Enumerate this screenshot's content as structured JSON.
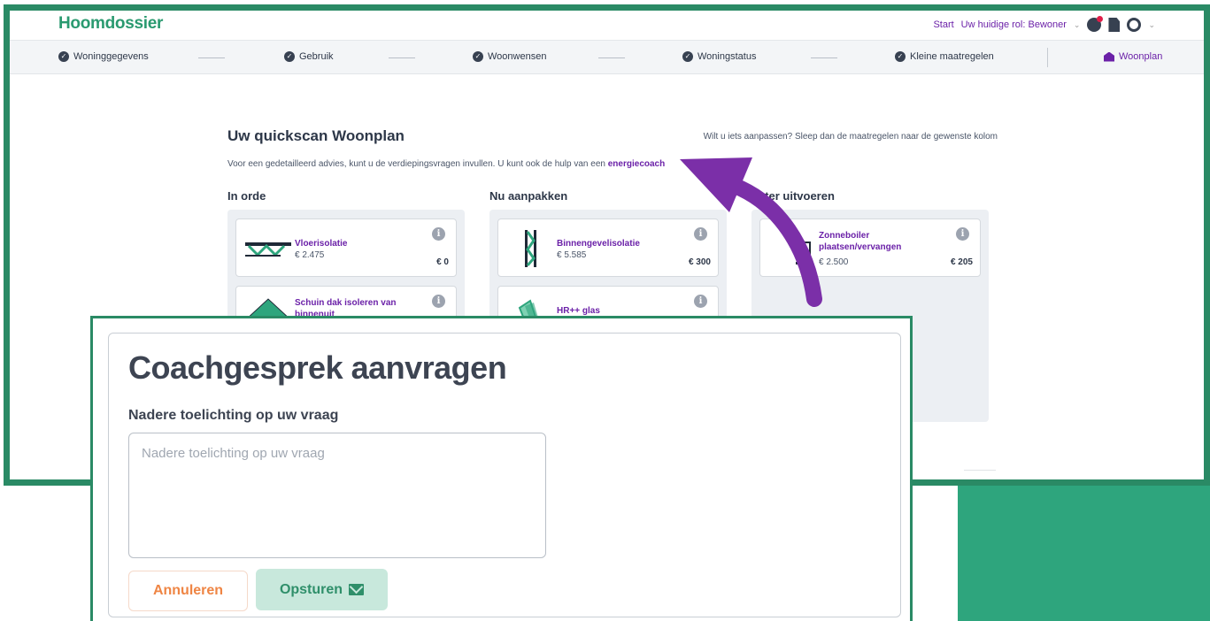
{
  "app": {
    "logo": "Hoomdossier"
  },
  "topnav": {
    "start": "Start",
    "role_label": "Uw huidige rol: Bewoner"
  },
  "steps": [
    {
      "label": "Woninggegevens"
    },
    {
      "label": "Gebruik"
    },
    {
      "label": "Woonwensen"
    },
    {
      "label": "Woningstatus"
    },
    {
      "label": "Kleine maatregelen"
    },
    {
      "label": "Woonplan"
    }
  ],
  "plan": {
    "title": "Uw quickscan Woonplan",
    "hint": "Wilt u iets aanpassen? Sleep dan de maatregelen naar de gewenste kolom",
    "subtitle": "Voor een gedetailleerd advies, kunt u de verdiepingsvragen invullen. U kunt ook de hulp van een",
    "subtitle_link": "energiecoach",
    "columns": [
      {
        "title": "In orde",
        "cards": [
          {
            "name": "Vloerisolatie",
            "price": "€ 2.475",
            "subsidy": "€ 0"
          },
          {
            "name": "Schuin dak isoleren van binnenuit",
            "price": "",
            "subsidy": ""
          }
        ]
      },
      {
        "title": "Nu aanpakken",
        "cards": [
          {
            "name": "Binnengevelisolatie",
            "price": "€ 5.585",
            "subsidy": "€ 300"
          },
          {
            "name": "HR++ glas",
            "price": "",
            "subsidy": ""
          }
        ]
      },
      {
        "title": "Later uitvoeren",
        "cards": [
          {
            "name": "Zonneboiler plaatsen/vervangen",
            "price": "€ 2.500",
            "subsidy": "€ 205"
          }
        ]
      }
    ]
  },
  "modal": {
    "title": "Coachgesprek aanvragen",
    "label": "Nadere toelichting op uw vraag",
    "placeholder": "Nadere toelichting op uw vraag",
    "cancel": "Annuleren",
    "send": "Opsturen"
  },
  "colors": {
    "brand": "#2a9a70",
    "accent": "#6b21a8",
    "frame": "#2a8a65",
    "cancel": "#ef8544"
  }
}
